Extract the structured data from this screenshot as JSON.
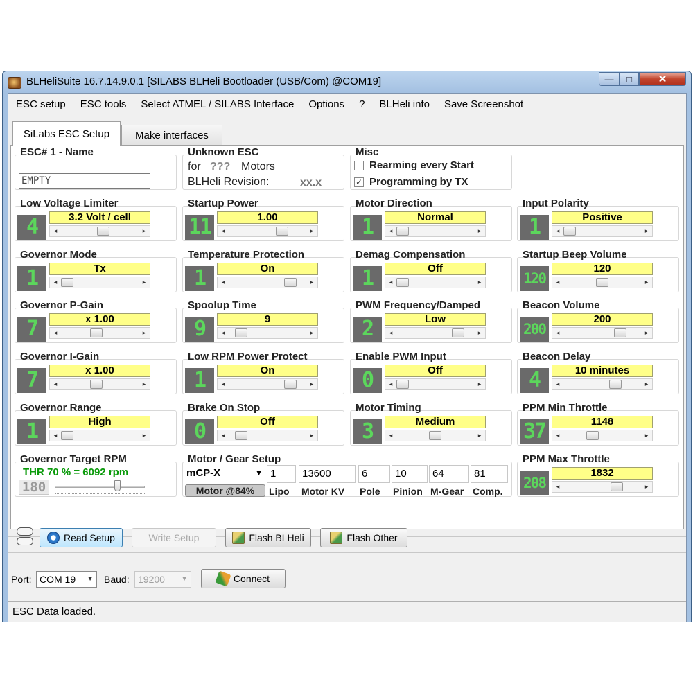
{
  "window": {
    "title": "BLHeliSuite 16.7.14.9.0.1  [SILABS BLHeli Bootloader (USB/Com) @COM19]",
    "min": "—",
    "max": "□",
    "close": "✕"
  },
  "menu": [
    "ESC setup",
    "ESC tools",
    "Select ATMEL / SILABS Interface",
    "Options",
    "?",
    "BLHeli info",
    "Save Screenshot"
  ],
  "tabs": [
    "SiLabs ESC Setup",
    "Make interfaces"
  ],
  "esc_name": {
    "title": "ESC# 1 - Name",
    "value": "EMPTY"
  },
  "unknown_esc": {
    "title": "Unknown ESC",
    "motors_pre": "for",
    "motors_q": "???",
    "motors_post": "Motors",
    "rev_label": "BLHeli Revision:",
    "rev_value": "xx.x"
  },
  "misc": {
    "title": "Misc",
    "rearming": "Rearming every Start",
    "rearming_checked": false,
    "programming": "Programming by TX",
    "programming_checked": true
  },
  "params": [
    {
      "title": "Low Voltage Limiter",
      "num": "4",
      "value": "3.2 Volt / cell",
      "pos": 0.55
    },
    {
      "title": "Startup Power",
      "num": "11",
      "value": "1.00",
      "pos": 0.72
    },
    {
      "title": "Motor Direction",
      "num": "1",
      "value": "Normal",
      "pos": 0.0
    },
    {
      "title": "Input Polarity",
      "num": "1",
      "value": "Positive",
      "pos": 0.0
    },
    {
      "title": "Governor Mode",
      "num": "1",
      "value": "Tx",
      "pos": 0.0
    },
    {
      "title": "Temperature Protection",
      "num": "1",
      "value": "On",
      "pos": 0.85
    },
    {
      "title": "Demag Compensation",
      "num": "1",
      "value": "Off",
      "pos": 0.0
    },
    {
      "title": "Startup Beep Volume",
      "num": "120",
      "value": "120",
      "pos": 0.5
    },
    {
      "title": "Governor P-Gain",
      "num": "7",
      "value": "x 1.00",
      "pos": 0.45
    },
    {
      "title": "Spoolup Time",
      "num": "9",
      "value": "9",
      "pos": 0.1
    },
    {
      "title": "PWM Frequency/Damped",
      "num": "2",
      "value": "Low",
      "pos": 0.85
    },
    {
      "title": "Beacon Volume",
      "num": "200",
      "value": "200",
      "pos": 0.78
    },
    {
      "title": "Governor I-Gain",
      "num": "7",
      "value": "x 1.00",
      "pos": 0.45
    },
    {
      "title": "Low RPM Power Protect",
      "num": "1",
      "value": "On",
      "pos": 0.85
    },
    {
      "title": "Enable PWM Input",
      "num": "0",
      "value": "Off",
      "pos": 0.0
    },
    {
      "title": "Beacon Delay",
      "num": "4",
      "value": "10 minutes",
      "pos": 0.7
    },
    {
      "title": "Governor Range",
      "num": "1",
      "value": "High",
      "pos": 0.0
    },
    {
      "title": "Brake On Stop",
      "num": "0",
      "value": "Off",
      "pos": 0.1
    },
    {
      "title": "Motor Timing",
      "num": "3",
      "value": "Medium",
      "pos": 0.5
    },
    {
      "title": "PPM Min Throttle",
      "num": "37",
      "value": "1148",
      "pos": 0.35
    }
  ],
  "gov_target": {
    "title": "Governor Target RPM",
    "rpm": "THR 70 % = 6092 rpm",
    "num": "180"
  },
  "motor_gear": {
    "title": "Motor / Gear Setup",
    "model": "mCP-X",
    "lipo": "1",
    "kv": "13600",
    "pole": "6",
    "pinion": "10",
    "mgear": "64",
    "comp": "81",
    "motor_pct": "Motor @84%",
    "lbl_lipo": "Lipo",
    "lbl_kv": "Motor KV",
    "lbl_pole": "Pole",
    "lbl_pinion": "Pinion",
    "lbl_mgear": "M-Gear",
    "lbl_comp": "Comp."
  },
  "ppm_max": {
    "title": "PPM Max Throttle",
    "num": "208",
    "value": "1832",
    "pos": 0.72
  },
  "buttons": {
    "read": "Read Setup",
    "write": "Write Setup",
    "flash_blheli": "Flash BLHeli",
    "flash_other": "Flash Other",
    "connect": "Connect"
  },
  "port": {
    "label": "Port:",
    "value": "COM 19",
    "baud_label": "Baud:",
    "baud_value": "19200"
  },
  "status": "ESC Data loaded.",
  "arrows": {
    "left": "◂",
    "right": "▸",
    "down": "▼"
  }
}
